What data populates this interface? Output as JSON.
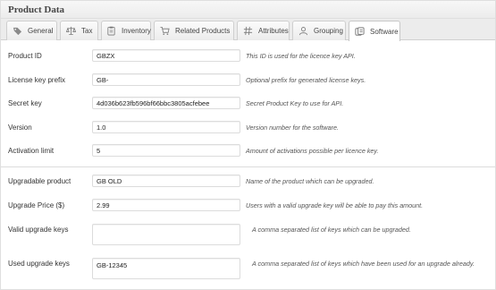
{
  "panel": {
    "title": "Product Data"
  },
  "tabs": [
    {
      "label": "General",
      "icon": "tag-icon",
      "active": false
    },
    {
      "label": "Tax",
      "icon": "scales-icon",
      "active": false
    },
    {
      "label": "Inventory",
      "icon": "clipboard-icon",
      "active": false
    },
    {
      "label": "Related Products",
      "icon": "cart-icon",
      "active": false
    },
    {
      "label": "Attributes",
      "icon": "hashtag-icon",
      "active": false
    },
    {
      "label": "Grouping",
      "icon": "user-group-icon",
      "active": false
    },
    {
      "label": "Software",
      "icon": "software-icon",
      "active": true
    }
  ],
  "fields": {
    "product_id": {
      "label": "Product ID",
      "value": "GBZX",
      "desc": "This ID is used for the licence key API."
    },
    "license_prefix": {
      "label": "License key prefix",
      "value": "GB-",
      "desc": "Optional prefix for generated license keys."
    },
    "secret_key": {
      "label": "Secret key",
      "value": "4d036b623fb596bf66bbc3805acfebee",
      "desc": "Secret Product Key to use for API."
    },
    "version": {
      "label": "Version",
      "value": "1.0",
      "desc": "Version number for the software."
    },
    "activation_limit": {
      "label": "Activation limit",
      "value": "5",
      "desc": "Amount of activations possible per licence key."
    },
    "upgradable_product": {
      "label": "Upgradable product",
      "value": "GB OLD",
      "desc": "Name of the product which can be upgraded."
    },
    "upgrade_price": {
      "label": "Upgrade Price ($)",
      "value": "2.99",
      "desc": "Users with a valid upgrade key will be able to pay this amount."
    },
    "valid_upgrade_keys": {
      "label": "Valid upgrade keys",
      "value": "",
      "desc": "A comma separated list of keys which can be upgraded."
    },
    "used_upgrade_keys": {
      "label": "Used upgrade keys",
      "value": "GB-12345",
      "desc": "A comma separated list of keys which have been used for an upgrade already."
    }
  }
}
